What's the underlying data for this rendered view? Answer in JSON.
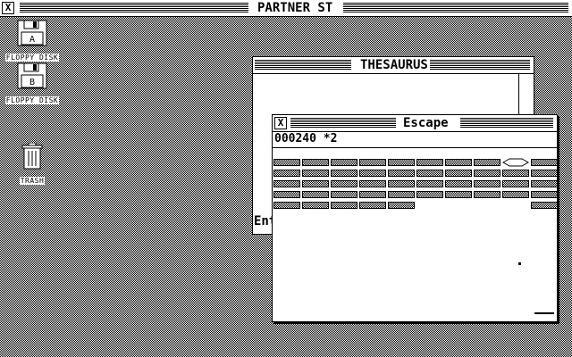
{
  "desktop": {
    "title": "PARTNER ST",
    "close_glyph": "X",
    "icons": [
      {
        "label": "FLOPPY DISK",
        "drive": "A",
        "icon": "floppy-disk-icon"
      },
      {
        "label": "FLOPPY DISK",
        "drive": "B",
        "icon": "floppy-disk-icon"
      },
      {
        "label": "TRASH",
        "icon": "trash-can-icon"
      }
    ]
  },
  "thesaurus_window": {
    "title": "THESAURUS",
    "entry_label": "Ent"
  },
  "game_window": {
    "title": "Escape",
    "close_glyph": "X",
    "score": "000240",
    "lives": "*2",
    "brick_rows": [
      [
        1,
        1,
        1,
        1,
        1,
        1,
        1,
        1,
        "diamond",
        1
      ],
      [
        1,
        1,
        1,
        1,
        1,
        1,
        1,
        1,
        1,
        1
      ],
      [
        1,
        1,
        1,
        1,
        1,
        1,
        1,
        1,
        1,
        1
      ],
      [
        1,
        1,
        1,
        1,
        1,
        1,
        1,
        1,
        1,
        1
      ],
      [
        1,
        1,
        1,
        1,
        1,
        0,
        0,
        0,
        0,
        1
      ]
    ]
  }
}
